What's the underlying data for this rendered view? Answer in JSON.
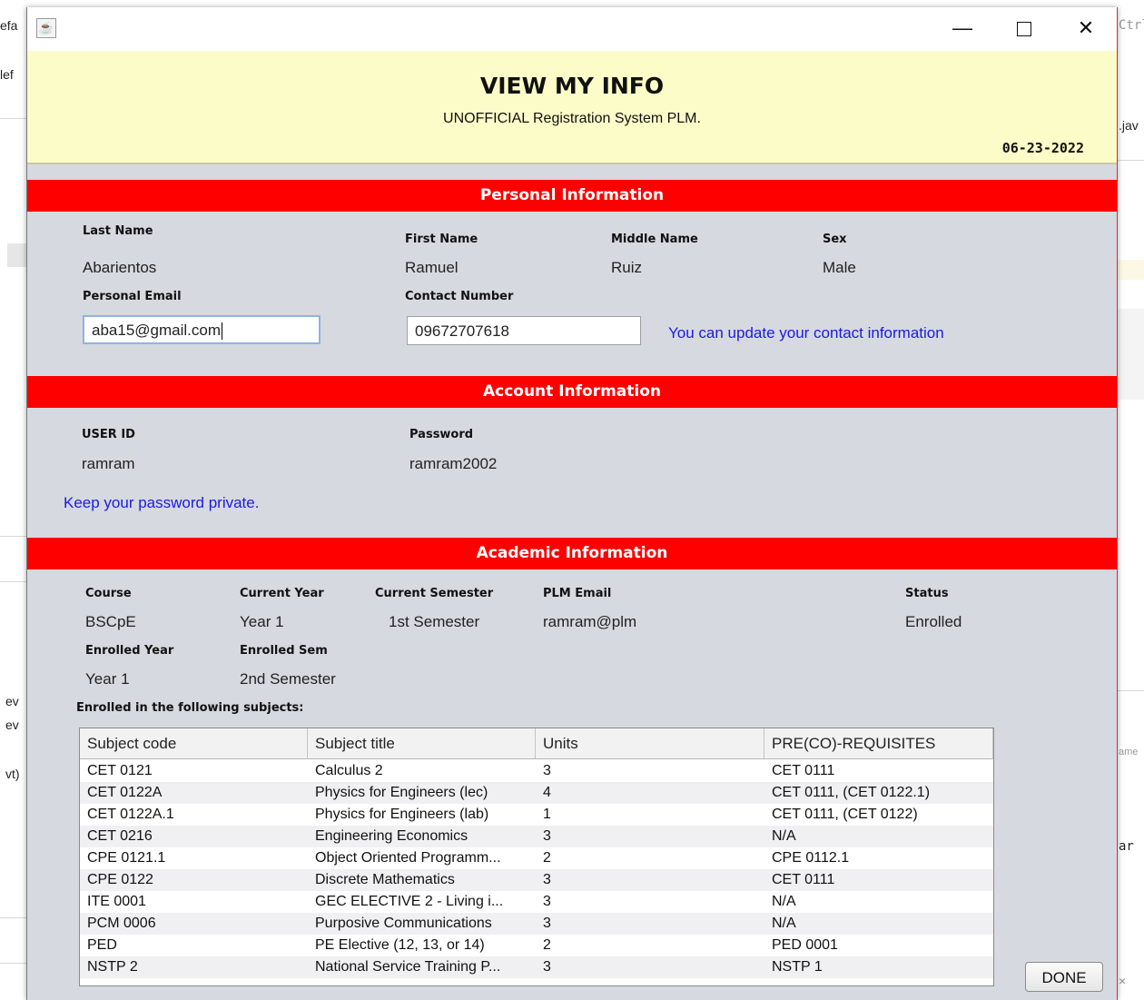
{
  "background": {
    "fragments": [
      "efa",
      "lef",
      "Ctrl-",
      ".jav",
      "ev",
      "ev",
      "vt)",
      "ame",
      "ar"
    ]
  },
  "window": {
    "app_icon": "java-cup-icon",
    "controls": {
      "minimize": "—",
      "close": "✕"
    }
  },
  "header": {
    "title": "VIEW MY INFO",
    "subtitle": "UNOFFICIAL Registration System PLM.",
    "date": "06-23-2022"
  },
  "personal": {
    "section_title": "Personal Information",
    "last_name_label": "Last Name",
    "last_name": "Abarientos",
    "first_name_label": "First Name",
    "first_name": "Ramuel",
    "middle_name_label": "Middle Name",
    "middle_name": "Ruiz",
    "sex_label": "Sex",
    "sex": "Male",
    "email_label": "Personal Email",
    "email_value": "aba15@gmail.com",
    "contact_label": "Contact Number",
    "contact_value": "09672707618",
    "update_note": "You can update your contact information"
  },
  "account": {
    "section_title": "Account Information",
    "user_id_label": "USER ID",
    "user_id": "ramram",
    "password_label": "Password",
    "password": "ramram2002",
    "note": "Keep your password private."
  },
  "academic": {
    "section_title": "Academic Information",
    "course_label": "Course",
    "course": "BSCpE",
    "current_year_label": "Current Year",
    "current_year": "Year 1",
    "current_sem_label": "Current Semester",
    "current_sem": "1st Semester",
    "plm_email_label": "PLM Email",
    "plm_email": "ramram@plm",
    "status_label": "Status",
    "status": "Enrolled",
    "enrolled_year_label": "Enrolled Year",
    "enrolled_year": "Year 1",
    "enrolled_sem_label": "Enrolled Sem",
    "enrolled_sem": "2nd Semester",
    "subjects_label": "Enrolled in the following subjects:"
  },
  "table": {
    "columns": [
      "Subject code",
      "Subject title",
      "Units",
      "PRE(CO)-REQUISITES"
    ],
    "rows": [
      [
        "CET 0121",
        "Calculus 2",
        "3",
        "CET 0111"
      ],
      [
        "CET 0122A",
        "Physics for Engineers (lec)",
        "4",
        "CET 0111, (CET 0122.1)"
      ],
      [
        "CET 0122A.1",
        "Physics for Engineers (lab)",
        "1",
        "CET 0111, (CET 0122)"
      ],
      [
        "CET 0216",
        "Engineering Economics",
        "3",
        "N/A"
      ],
      [
        "CPE 0121.1",
        "Object Oriented Programm...",
        "2",
        "CPE 0112.1"
      ],
      [
        "CPE 0122",
        "Discrete Mathematics",
        "3",
        "CET 0111"
      ],
      [
        "ITE 0001",
        "GEC ELECTIVE 2 - Living i...",
        "3",
        "N/A"
      ],
      [
        "PCM 0006",
        "Purposive Communications",
        "3",
        "N/A"
      ],
      [
        "PED",
        "PE Elective (12, 13, or 14)",
        "2",
        "PED 0001"
      ],
      [
        "NSTP 2",
        "National Service Training P...",
        "3",
        "NSTP 1"
      ]
    ]
  },
  "done_label": "DONE"
}
